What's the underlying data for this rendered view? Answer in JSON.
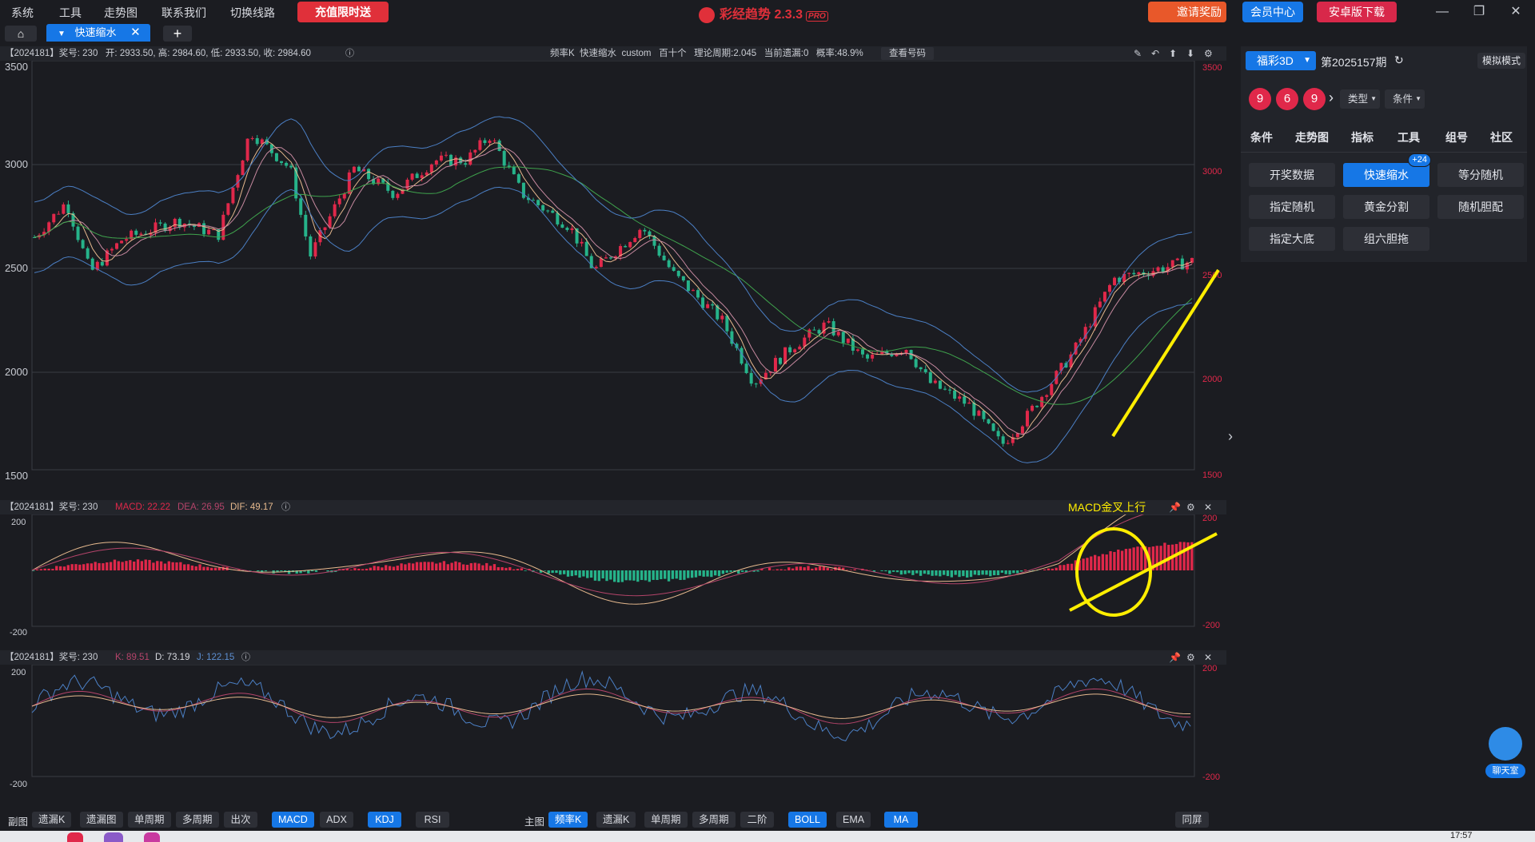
{
  "menu": {
    "items": [
      "系统",
      "工具",
      "走势图",
      "联系我们",
      "切换线路"
    ],
    "promo_label": "充值限时送",
    "app_title": "彩经趋势 2.3.3",
    "app_badge": "PRO",
    "invite_label": "邀请奖励",
    "member_label": "会员中心",
    "android_label": "安卓版下载"
  },
  "tabs": {
    "active_label": "快速缩水",
    "add_label": "+"
  },
  "main_chart": {
    "header": "【2024181】奖号: 230   开: 2933.50, 高: 2984.60, 低: 2933.50, 收: 2984.60",
    "center_info": "频率K  快速缩水  custom   百十个   理论周期:2.045   当前遗漏:0   概率:48.9%",
    "lookup_label": "查看号码",
    "y_ticks": [
      "3500",
      "3000",
      "2500",
      "2000",
      "1500"
    ]
  },
  "macd_panel": {
    "prefix": "【2024181】奖号: 230 ",
    "macd_text": "MACD: 22.22",
    "dea_text": "DEA: 26.95",
    "dif_text": "DIF: 49.17",
    "annotation": "MACD金叉上行",
    "y_ticks": [
      "200",
      "-200"
    ]
  },
  "kdj_panel": {
    "prefix": "【2024181】奖号: 230 ",
    "k_text": "K: 89.51",
    "d_text": "D: 73.19",
    "j_text": "J: 122.15",
    "y_ticks": [
      "200",
      "-200"
    ]
  },
  "bottom": {
    "sub_label": "副图",
    "sub_buttons": [
      "遗漏K",
      "遗漏图",
      "单周期",
      "多周期",
      "出次",
      "MACD",
      "ADX",
      "KDJ",
      "RSI"
    ],
    "main_label": "主图",
    "main_buttons": [
      "频率K",
      "遗漏K",
      "单周期",
      "多周期",
      "二阶",
      "BOLL",
      "EMA",
      "MA"
    ],
    "sync_label": "同屏"
  },
  "sidebar": {
    "lottery": "福彩3D",
    "period": "第2025157期",
    "mode_label": "模拟模式",
    "balls": [
      "9",
      "6",
      "9"
    ],
    "type_label": "类型",
    "cond_label": "条件",
    "tabs": [
      "条件",
      "走势图",
      "指标",
      "工具",
      "组号",
      "社区"
    ],
    "functions": [
      "开奖数据",
      "快速缩水",
      "等分随机",
      "指定随机",
      "黄金分割",
      "随机胆配",
      "指定大底",
      "组六胆拖"
    ],
    "badge": "+24",
    "chat_label": "聊天室"
  },
  "taskbar": {
    "time": "17:57"
  },
  "colors": {
    "accent": "#1677e6",
    "red": "#e0284a",
    "green": "#26b38a",
    "annotation": "#ffee00"
  }
}
